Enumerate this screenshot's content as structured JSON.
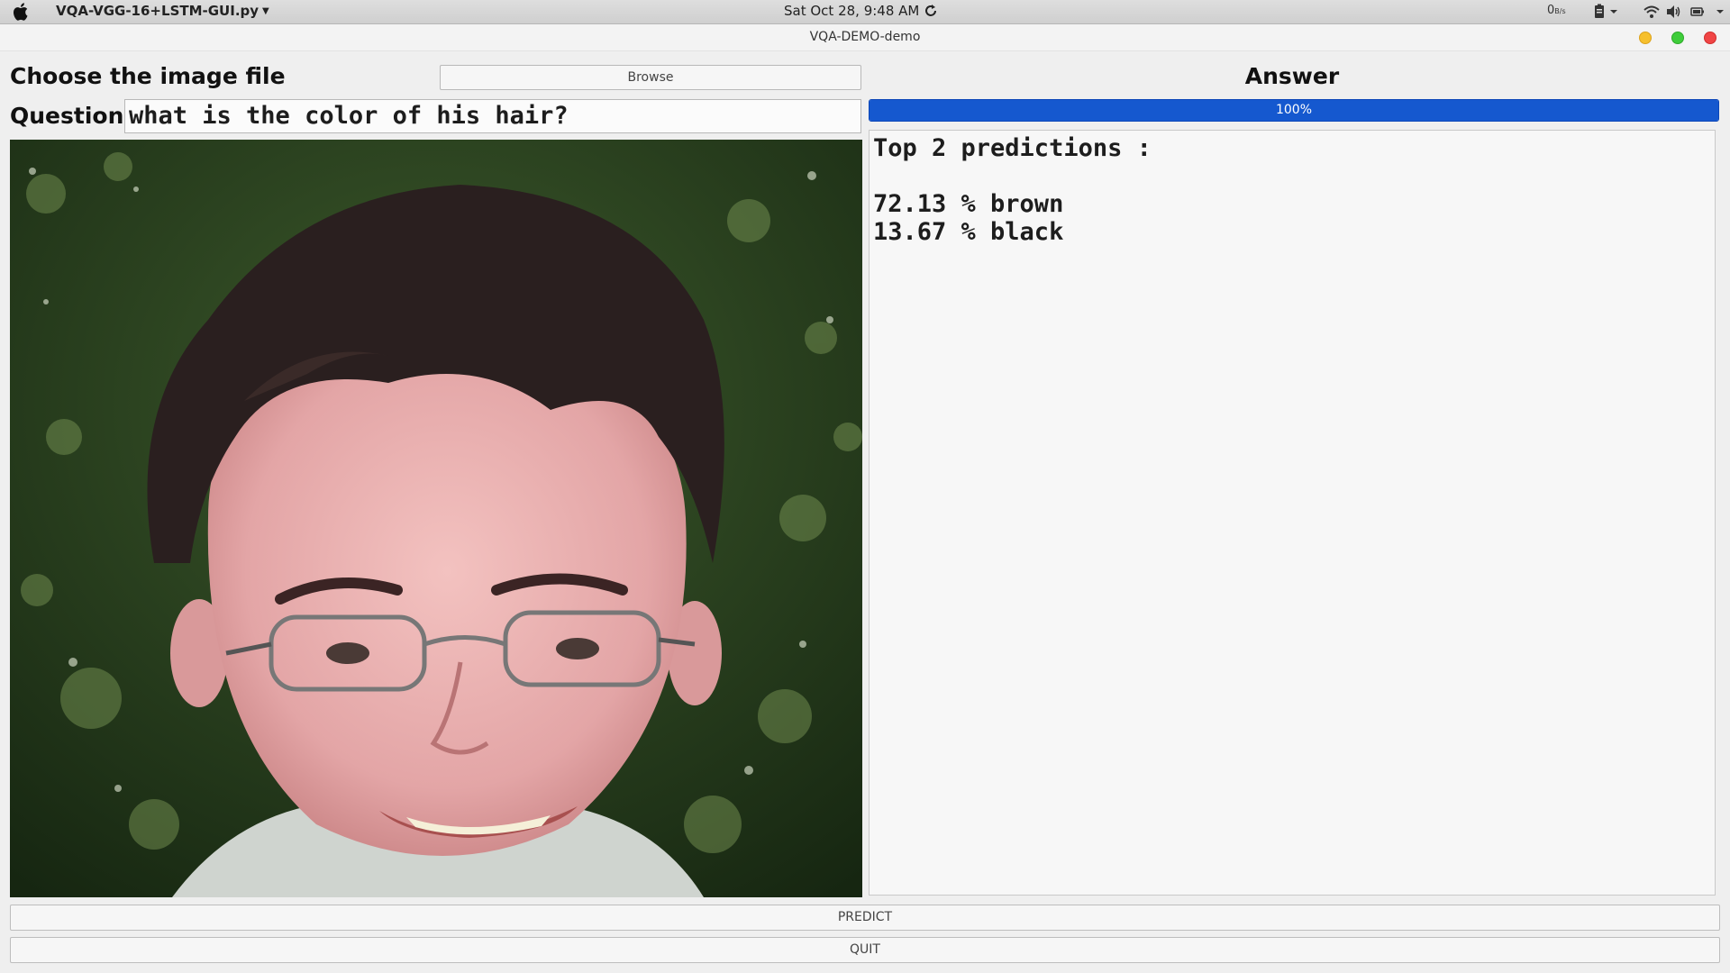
{
  "menubar": {
    "app_name": "VQA-VGG-16+LSTM-GUI.py",
    "clock": "Sat Oct 28,  9:48 AM",
    "net_speed": "0",
    "net_speed_unit": "B/s"
  },
  "window": {
    "title": "VQA-DEMO-demo",
    "controls": {
      "minimize_color": "#f6c02e",
      "maximize_color": "#3fcd3b",
      "close_color": "#f04545"
    }
  },
  "left_panel": {
    "choose_label": "Choose the image file",
    "browse_label": "Browse",
    "question_label": "Question",
    "question_value": "what is the color of his hair?",
    "image_icon": "portrait-photo"
  },
  "right_panel": {
    "answer_title": "Answer",
    "progress": {
      "value": 1.0,
      "label": "100%",
      "fill_color": "#1558cf"
    },
    "predictions_header": "Top 2 predictions :",
    "predictions": [
      {
        "text": "72.13 % brown"
      },
      {
        "text": "13.67 % black"
      }
    ]
  },
  "actions": {
    "predict_label": "PREDICT",
    "quit_label": "QUIT"
  }
}
